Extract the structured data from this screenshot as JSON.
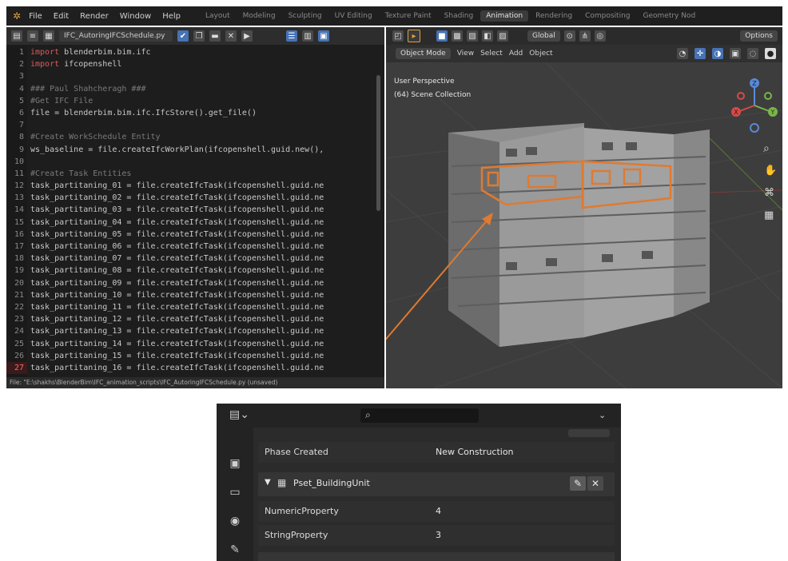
{
  "menubar": {
    "items": [
      "File",
      "Edit",
      "Render",
      "Window",
      "Help"
    ],
    "workspaces": [
      "Layout",
      "Modeling",
      "Sculpting",
      "UV Editing",
      "Texture Paint",
      "Shading",
      "Animation",
      "Rendering",
      "Compositing",
      "Geometry Nod"
    ],
    "active_workspace": "Animation"
  },
  "editor": {
    "filename": "IFC_AutoringIFCSchedule.py",
    "line_numbers": [
      "1",
      "2",
      "3",
      "4",
      "5",
      "6",
      "7",
      "8",
      "9",
      "10",
      "11",
      "12",
      "13",
      "14",
      "15",
      "16",
      "17",
      "18",
      "19",
      "20",
      "21",
      "22",
      "23",
      "24",
      "25",
      "26",
      "27"
    ],
    "current_line": "27",
    "lines": [
      {
        "kw": "import",
        "text": " blenderbim.bim.ifc"
      },
      {
        "kw": "import",
        "text": " ifcopenshell"
      },
      {
        "text": ""
      },
      {
        "cm": "### Paul Shahcheragh ###"
      },
      {
        "cm": "#Get IFC File"
      },
      {
        "text": "file = blenderbim.bim.ifc.IfcStore().get_file()"
      },
      {
        "text": ""
      },
      {
        "cm": "#Create WorkSchedule Entity"
      },
      {
        "text": "ws_baseline = file.createIfcWorkPlan(ifcopenshell.guid.new(),"
      },
      {
        "text": ""
      },
      {
        "cm": "#Create Task Entities"
      },
      {
        "text": "task_partitaning_01 = file.createIfcTask(ifcopenshell.guid.ne"
      },
      {
        "text": "task_partitaning_02 = file.createIfcTask(ifcopenshell.guid.ne"
      },
      {
        "text": "task_partitaning_03 = file.createIfcTask(ifcopenshell.guid.ne"
      },
      {
        "text": "task_partitaning_04 = file.createIfcTask(ifcopenshell.guid.ne"
      },
      {
        "text": "task_partitaning_05 = file.createIfcTask(ifcopenshell.guid.ne"
      },
      {
        "text": "task_partitaning_06 = file.createIfcTask(ifcopenshell.guid.ne"
      },
      {
        "text": "task_partitaning_07 = file.createIfcTask(ifcopenshell.guid.ne"
      },
      {
        "text": "task_partitaning_08 = file.createIfcTask(ifcopenshell.guid.ne"
      },
      {
        "text": "task_partitaning_09 = file.createIfcTask(ifcopenshell.guid.ne"
      },
      {
        "text": "task_partitaning_10 = file.createIfcTask(ifcopenshell.guid.ne"
      },
      {
        "text": "task_partitaning_11 = file.createIfcTask(ifcopenshell.guid.ne"
      },
      {
        "text": "task_partitaning_12 = file.createIfcTask(ifcopenshell.guid.ne"
      },
      {
        "text": "task_partitaning_13 = file.createIfcTask(ifcopenshell.guid.ne"
      },
      {
        "text": "task_partitaning_14 = file.createIfcTask(ifcopenshell.guid.ne"
      },
      {
        "text": "task_partitaning_15 = file.createIfcTask(ifcopenshell.guid.ne"
      },
      {
        "text": "task_partitaning_16 = file.createIfcTask(ifcopenshell.guid.ne"
      }
    ],
    "status": "File: \"E:\\shakhs\\BlenderBim\\IFC_animation_scripts\\IFC_AutoringIFCSchedule.py (unsaved)"
  },
  "viewport": {
    "mode": "Object Mode",
    "menus": [
      "View",
      "Select",
      "Add",
      "Object"
    ],
    "orientation": "Global",
    "options_label": "Options",
    "overlay_title": "User Perspective",
    "overlay_collection": "(64) Scene Collection",
    "axis_labels": [
      "Z",
      "Y",
      "X"
    ]
  },
  "properties": {
    "search_placeholder": "",
    "rows_top": [
      {
        "label": "Phase Created",
        "value": "New Construction"
      }
    ],
    "pset_name": "Pset_BuildingUnit",
    "pset_rows": [
      {
        "label": "NumericProperty",
        "value": "4"
      },
      {
        "label": "StringProperty",
        "value": "3"
      }
    ]
  },
  "colors": {
    "highlight_orange": "#e07a30",
    "keyword_red": "#e05a5a",
    "accent_blue": "#4772b3"
  }
}
